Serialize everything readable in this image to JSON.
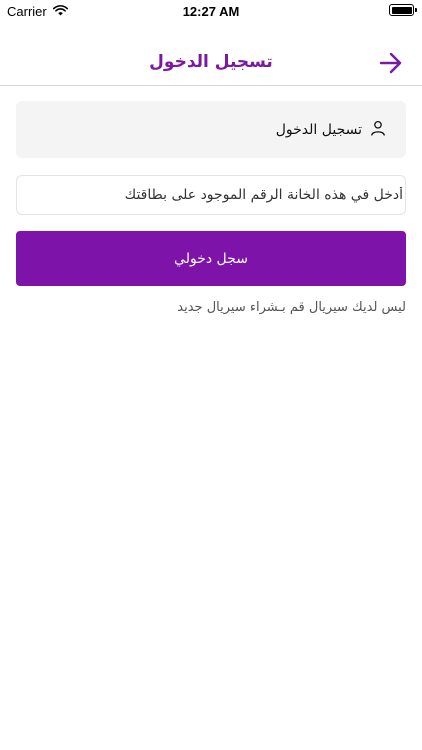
{
  "status_bar": {
    "carrier": "Carrier",
    "time": "12:27 AM",
    "battery_level": 1.0
  },
  "nav": {
    "title": "تسجيل الدخول",
    "back_icon": "arrow-right-icon"
  },
  "login_box": {
    "label": "تسجيل الدخول",
    "icon": "user-icon"
  },
  "serial_input": {
    "placeholder": "أدخل في هذه الخانة الرقم الموجود على بطاقتك",
    "value": ""
  },
  "login_button": {
    "label": "سجل دخولي"
  },
  "no_serial_link": {
    "label": "ليس لديك سيريال قم بـشراء سيريال جديد"
  },
  "colors": {
    "accent": "#7d13a9",
    "title": "#7a1aa2"
  }
}
